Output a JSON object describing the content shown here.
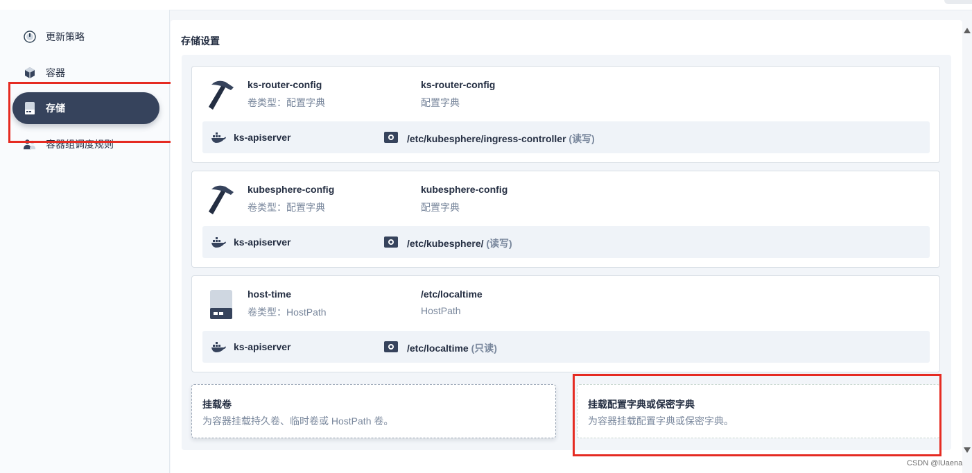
{
  "sidebar": {
    "items": [
      {
        "label": "更新策略",
        "icon": "update-strategy-icon"
      },
      {
        "label": "容器",
        "icon": "container-icon"
      },
      {
        "label": "存储",
        "icon": "storage-icon",
        "active": true
      },
      {
        "label": "容器组调度规则",
        "icon": "scheduling-rules-icon"
      }
    ]
  },
  "main": {
    "title": "存储设置",
    "volumes": [
      {
        "name": "ks-router-config",
        "type": "卷类型：配置字典",
        "source": "ks-router-config",
        "source_type": "配置字典",
        "icon": "hammer-icon",
        "mount": {
          "container": "ks-apiserver",
          "path": "/etc/kubesphere/ingress-controller",
          "mode": "(读写)"
        }
      },
      {
        "name": "kubesphere-config",
        "type": "卷类型：配置字典",
        "source": "kubesphere-config",
        "source_type": "配置字典",
        "icon": "hammer-icon",
        "mount": {
          "container": "ks-apiserver",
          "path": "/etc/kubesphere/",
          "mode": "(读写)"
        }
      },
      {
        "name": "host-time",
        "type": "卷类型：HostPath",
        "source": "/etc/localtime",
        "source_type": "HostPath",
        "icon": "disk-icon",
        "mount": {
          "container": "ks-apiserver",
          "path": "/etc/localtime",
          "mode": "(只读)"
        }
      }
    ],
    "actions": {
      "mount_volume": {
        "title": "挂载卷",
        "desc": "为容器挂载持久卷、临时卷或 HostPath 卷。"
      },
      "mount_config": {
        "title": "挂载配置字典或保密字典",
        "desc": "为容器挂载配置字典或保密字典。"
      }
    }
  },
  "watermark": "CSDN @lUaena",
  "colors": {
    "accent": "#36435c",
    "annotation": "#e52b22"
  }
}
